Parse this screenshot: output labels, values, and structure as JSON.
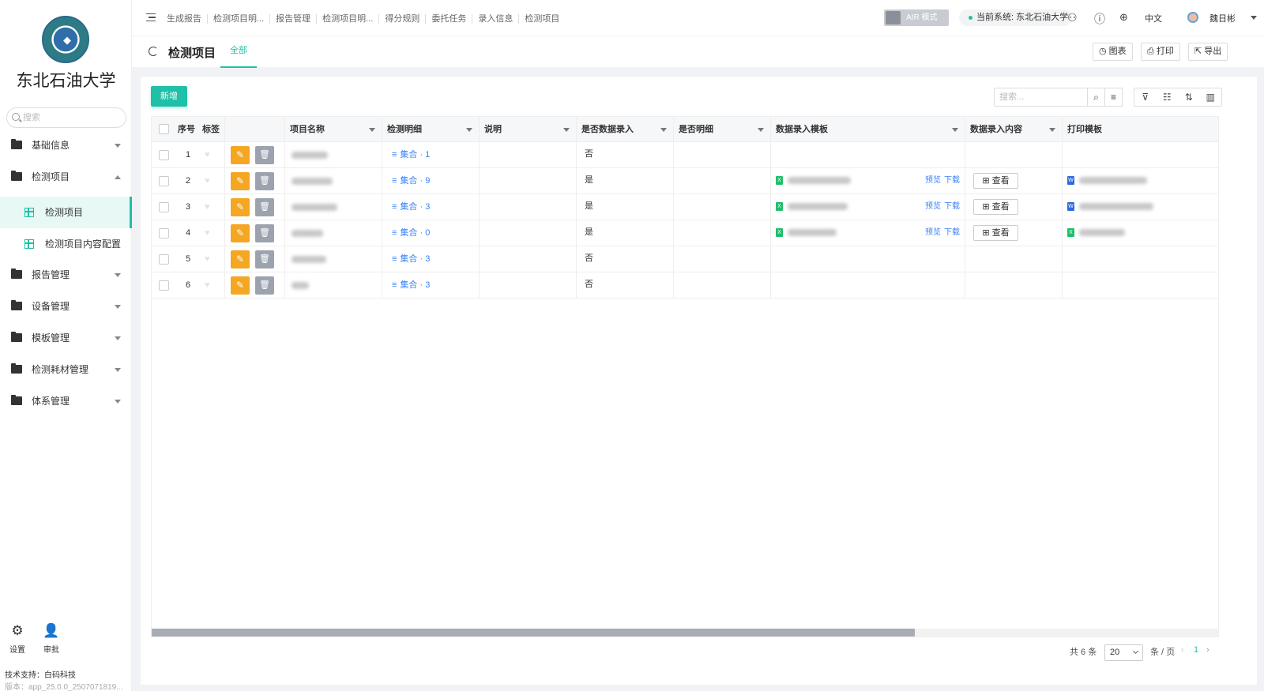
{
  "sidebar": {
    "logo_text": "东北石油大学",
    "school_name": "东北石油大学",
    "search_placeholder": "搜索",
    "menu": [
      {
        "label": "基础信息"
      },
      {
        "label": "检测项目"
      },
      {
        "label": "报告管理"
      },
      {
        "label": "设备管理"
      },
      {
        "label": "模板管理"
      },
      {
        "label": "检测耗材管理"
      },
      {
        "label": "体系管理"
      }
    ],
    "submenu": [
      {
        "label": "检测项目"
      },
      {
        "label": "检测项目内容配置"
      }
    ],
    "settings_label": "设置",
    "approve_label": "审批",
    "support": "技术支持：白码科技",
    "version": "版本：app_25.0.0_2507071819..."
  },
  "topbar": {
    "breadcrumbs": [
      "生成报告",
      "检测项目明...",
      "报告管理",
      "检测项目明...",
      "得分规则",
      "委托任务",
      "录入信息",
      "检测项目"
    ],
    "air_mode": "AIR 模式",
    "current_system": "当前系统: 东北石油大学",
    "language": "中文",
    "user_name": "魏日彬"
  },
  "page_header": {
    "title": "检测项目",
    "tab": "全部",
    "chart_btn": "图表",
    "print_btn": "打印",
    "export_btn": "导出"
  },
  "toolbar": {
    "add_label": "新增",
    "search_placeholder": "搜索..."
  },
  "table": {
    "columns": [
      "序号",
      "标签",
      "项目名称",
      "检测明细",
      "说明",
      "是否数据录入",
      "是否明细",
      "数据录入模板",
      "数据录入内容",
      "打印模板"
    ],
    "rows": [
      {
        "index": "1",
        "detail": "集合 · 1",
        "data_entry": "否",
        "has_template": false,
        "print_type": ""
      },
      {
        "index": "2",
        "detail": "集合 · 9",
        "data_entry": "是",
        "has_template": true,
        "print_type": "doc"
      },
      {
        "index": "3",
        "detail": "集合 · 3",
        "data_entry": "是",
        "has_template": true,
        "print_type": "doc"
      },
      {
        "index": "4",
        "detail": "集合 · 0",
        "data_entry": "是",
        "has_template": true,
        "print_type": "xls"
      },
      {
        "index": "5",
        "detail": "集合 · 3",
        "data_entry": "否",
        "has_template": false,
        "print_type": ""
      },
      {
        "index": "6",
        "detail": "集合 · 3",
        "data_entry": "否",
        "has_template": false,
        "print_type": ""
      }
    ],
    "preview_label": "预览",
    "download_label": "下载",
    "view_label": "查看"
  },
  "pagination": {
    "total": "共 6 条",
    "page_size": "20",
    "per_page": "条 / 页",
    "current_page": "1"
  },
  "colors": {
    "accent": "#1fbfa8",
    "edit": "#f5a623",
    "delete": "#9ca3af",
    "link": "#3b82f6"
  }
}
